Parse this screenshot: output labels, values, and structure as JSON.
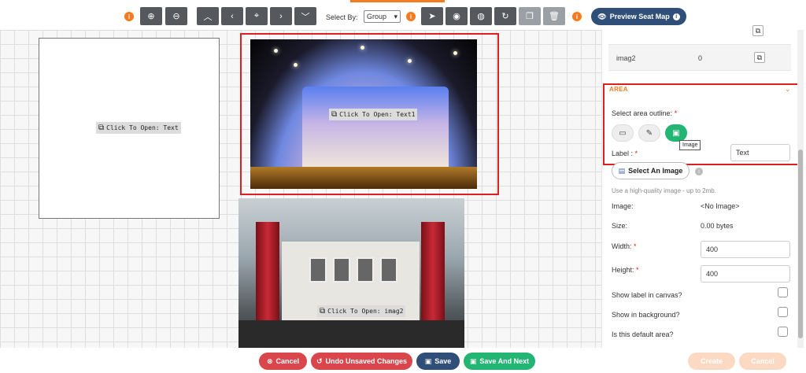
{
  "toolbar": {
    "zoom_in": "+",
    "zoom_out": "−",
    "select_by_label": "Select By:",
    "select_by_value": "Group",
    "preview_label": "Preview Seat Map"
  },
  "canvas": {
    "shapes": [
      {
        "open_label": "Click To Open: Text"
      },
      {
        "open_label": "Click To Open: Text1"
      },
      {
        "open_label": "Click To Open: imag2"
      }
    ]
  },
  "panel": {
    "list_row": {
      "name": "imag2",
      "count": "0"
    },
    "area": {
      "title": "AREA",
      "outline_label": "Select area outline:",
      "tooltip": "Image",
      "label_label": "Label :",
      "label_value": "Text"
    },
    "select_image_label": "Select An Image",
    "hint": "Use a high-quality image - up to 2mb.",
    "image_label": "Image:",
    "image_value": "<No Image>",
    "size_label": "Size:",
    "size_value": "0.00 bytes",
    "width_label": "Width:",
    "width_value": "400",
    "height_label": "Height:",
    "height_value": "400",
    "show_label_canvas": "Show label in canvas?",
    "show_background": "Show in background?",
    "default_area": "Is this default area?"
  },
  "bottom": {
    "cancel": "Cancel",
    "undo": "Undo Unsaved Changes",
    "save": "Save",
    "save_next": "Save And Next",
    "right_btn_1": "Create",
    "right_btn_2": "Cancel"
  },
  "colors": {
    "accent": "#f47b20",
    "navy": "#2f4f78",
    "green": "#22b573",
    "red": "#d9464c",
    "highlight": "#e02020"
  }
}
